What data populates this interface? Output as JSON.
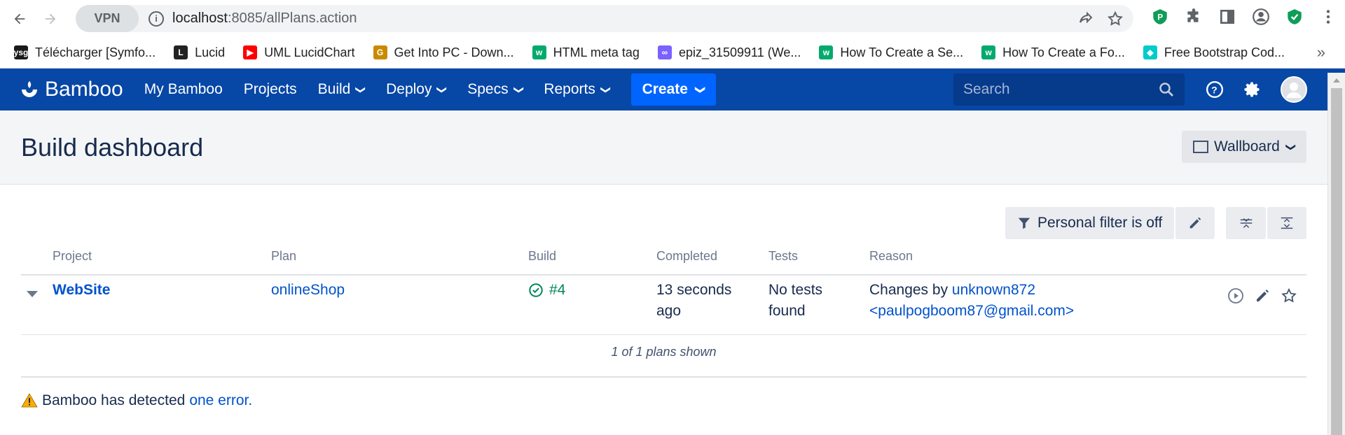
{
  "browser": {
    "url_host": "localhost",
    "url_path": ":8085/allPlans.action",
    "vpn_label": "VPN",
    "bookmarks": [
      {
        "label": "Télécharger [Symfo...",
        "color": "#1a1a1a",
        "glyph": "ysg"
      },
      {
        "label": "Lucid",
        "color": "#222",
        "glyph": "L"
      },
      {
        "label": "UML LucidChart",
        "color": "#ff0000",
        "glyph": "▶"
      },
      {
        "label": "Get Into PC - Down...",
        "color": "#c98a00",
        "glyph": "G"
      },
      {
        "label": "HTML meta tag",
        "color": "#04aa6d",
        "glyph": "w"
      },
      {
        "label": "epiz_31509911 (We...",
        "color": "#7b61ff",
        "glyph": "∞"
      },
      {
        "label": "How To Create a Se...",
        "color": "#04aa6d",
        "glyph": "w"
      },
      {
        "label": "How To Create a Fo...",
        "color": "#04aa6d",
        "glyph": "w"
      },
      {
        "label": "Free Bootstrap Cod...",
        "color": "#0cc",
        "glyph": "◆"
      }
    ],
    "bookmarks_more": "»"
  },
  "header": {
    "logo_text": "Bamboo",
    "nav": [
      {
        "label": "My Bamboo",
        "dropdown": false
      },
      {
        "label": "Projects",
        "dropdown": false
      },
      {
        "label": "Build",
        "dropdown": true
      },
      {
        "label": "Deploy",
        "dropdown": true
      },
      {
        "label": "Specs",
        "dropdown": true
      },
      {
        "label": "Reports",
        "dropdown": true
      }
    ],
    "create_label": "Create",
    "search_placeholder": "Search"
  },
  "page": {
    "title": "Build dashboard",
    "wallboard_label": "Wallboard",
    "filter_label": "Personal filter is off"
  },
  "table": {
    "columns": [
      "Project",
      "Plan",
      "Build",
      "Completed",
      "Tests",
      "Reason"
    ],
    "rows": [
      {
        "project": "WebSite",
        "plan": "onlineShop",
        "build": "#4",
        "completed_1": "13 seconds",
        "completed_2": "ago",
        "tests_1": "No tests",
        "tests_2": "found",
        "reason_prefix": "Changes by ",
        "reason_user": "unknown872",
        "reason_email": "<paulpogboom87@gmail.com>"
      }
    ],
    "shown_text": "1 of 1 plans shown"
  },
  "error": {
    "prefix": "Bamboo has detected ",
    "link": "one error."
  },
  "colors": {
    "header_bg": "#0747a6",
    "create_bg": "#0065ff",
    "link": "#0052cc",
    "success": "#00875a"
  }
}
